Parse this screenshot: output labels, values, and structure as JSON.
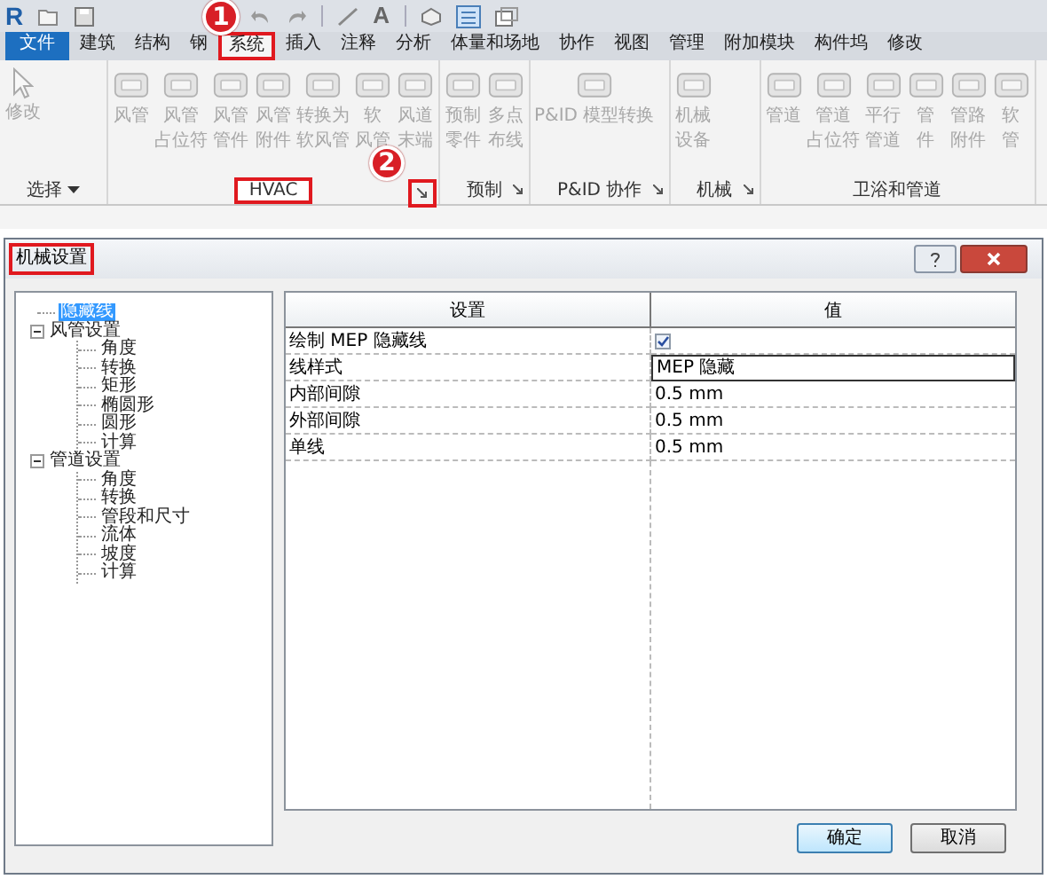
{
  "quick_access": {
    "logo": "R",
    "text_tool": "A"
  },
  "ribbon": {
    "tabs": [
      {
        "label": "文件",
        "kind": "file",
        "selected": false,
        "highlighted": false
      },
      {
        "label": "建筑",
        "kind": "tab",
        "selected": false,
        "highlighted": false
      },
      {
        "label": "结构",
        "kind": "tab",
        "selected": false,
        "highlighted": false
      },
      {
        "label": "钢",
        "kind": "tab",
        "selected": false,
        "highlighted": false
      },
      {
        "label": "系统",
        "kind": "tab",
        "selected": true,
        "highlighted": true
      },
      {
        "label": "插入",
        "kind": "tab",
        "selected": false,
        "highlighted": false
      },
      {
        "label": "注释",
        "kind": "tab",
        "selected": false,
        "highlighted": false
      },
      {
        "label": "分析",
        "kind": "tab",
        "selected": false,
        "highlighted": false
      },
      {
        "label": "体量和场地",
        "kind": "tab",
        "selected": false,
        "highlighted": false
      },
      {
        "label": "协作",
        "kind": "tab",
        "selected": false,
        "highlighted": false
      },
      {
        "label": "视图",
        "kind": "tab",
        "selected": false,
        "highlighted": false
      },
      {
        "label": "管理",
        "kind": "tab",
        "selected": false,
        "highlighted": false
      },
      {
        "label": "附加模块",
        "kind": "tab",
        "selected": false,
        "highlighted": false
      },
      {
        "label": "构件坞",
        "kind": "tab",
        "selected": false,
        "highlighted": false
      },
      {
        "label": "修改",
        "kind": "tab",
        "selected": false,
        "highlighted": false
      }
    ],
    "panels": [
      {
        "label": "选择",
        "dropdown": true,
        "highlighted": false,
        "buttons": [
          {
            "label": [
              "修改"
            ],
            "kind": "pointer",
            "disabled": true
          }
        ]
      },
      {
        "label": "HVAC",
        "highlighted": true,
        "launcher": {
          "highlighted": true
        },
        "buttons": [
          {
            "label": [
              "风管"
            ],
            "kind": "tool",
            "disabled": true
          },
          {
            "label": [
              "风管",
              "占位符"
            ],
            "kind": "tool",
            "disabled": true
          },
          {
            "label": [
              "风管",
              "管件"
            ],
            "kind": "tool",
            "disabled": true
          },
          {
            "label": [
              "风管",
              "附件"
            ],
            "kind": "tool",
            "disabled": true
          },
          {
            "label": [
              "转换为",
              "软风管"
            ],
            "kind": "tool",
            "disabled": true
          },
          {
            "label": [
              "软",
              "风管"
            ],
            "kind": "tool",
            "disabled": true
          },
          {
            "label": [
              "风道",
              "末端"
            ],
            "kind": "tool",
            "disabled": true
          }
        ]
      },
      {
        "label": "预制",
        "highlighted": false,
        "launcher": {
          "highlighted": false
        },
        "buttons": [
          {
            "label": [
              "预制",
              "零件"
            ],
            "kind": "tool",
            "disabled": true
          },
          {
            "label": [
              "多点",
              "布线"
            ],
            "kind": "tool",
            "disabled": true
          }
        ]
      },
      {
        "label": "P&ID 协作",
        "highlighted": false,
        "launcher": {
          "highlighted": false
        },
        "buttons": [
          {
            "label": [
              "P&ID 模型转换"
            ],
            "kind": "tool",
            "disabled": true
          }
        ]
      },
      {
        "label": "机械",
        "highlighted": false,
        "launcher": {
          "highlighted": false
        },
        "buttons": [
          {
            "label": [
              "机械",
              "设备"
            ],
            "kind": "tool",
            "disabled": true
          }
        ]
      },
      {
        "label": "卫浴和管道",
        "highlighted": false,
        "buttons": [
          {
            "label": [
              "管道"
            ],
            "kind": "tool",
            "disabled": true
          },
          {
            "label": [
              "管道",
              "占位符"
            ],
            "kind": "tool",
            "disabled": true
          },
          {
            "label": [
              "平行",
              "管道"
            ],
            "kind": "tool",
            "disabled": true
          },
          {
            "label": [
              "管",
              "件"
            ],
            "kind": "tool",
            "disabled": true
          },
          {
            "label": [
              "管路",
              "附件"
            ],
            "kind": "tool",
            "disabled": true
          },
          {
            "label": [
              "软",
              "管"
            ],
            "kind": "tool",
            "disabled": true
          }
        ]
      }
    ]
  },
  "callouts": [
    {
      "number": "1"
    },
    {
      "number": "2"
    }
  ],
  "dialog": {
    "title": "机械设置",
    "title_highlighted": true,
    "tree": [
      {
        "label": "隐藏线",
        "selected": true
      },
      {
        "label": "风管设置",
        "selected": false,
        "expanded": true,
        "children": [
          {
            "label": "角度",
            "selected": false
          },
          {
            "label": "转换",
            "selected": false
          },
          {
            "label": "矩形",
            "selected": false
          },
          {
            "label": "椭圆形",
            "selected": false
          },
          {
            "label": "圆形",
            "selected": false
          },
          {
            "label": "计算",
            "selected": false
          }
        ]
      },
      {
        "label": "管道设置",
        "selected": false,
        "expanded": true,
        "children": [
          {
            "label": "角度",
            "selected": false
          },
          {
            "label": "转换",
            "selected": false
          },
          {
            "label": "管段和尺寸",
            "selected": false
          },
          {
            "label": "流体",
            "selected": false
          },
          {
            "label": "坡度",
            "selected": false
          },
          {
            "label": "计算",
            "selected": false
          }
        ]
      }
    ],
    "table": {
      "columns": [
        "设置",
        "值"
      ],
      "rows": [
        {
          "setting": "绘制 MEP 隐藏线",
          "kind": "checkbox",
          "checked": true,
          "focused": false
        },
        {
          "setting": "线样式",
          "kind": "text",
          "value": "MEP 隐藏",
          "focused": true
        },
        {
          "setting": "内部间隙",
          "kind": "text",
          "value": "0.5 mm",
          "focused": false
        },
        {
          "setting": "外部间隙",
          "kind": "text",
          "value": "0.5 mm",
          "focused": false
        },
        {
          "setting": "单线",
          "kind": "text",
          "value": "0.5 mm",
          "focused": false
        }
      ]
    },
    "buttons": [
      {
        "label": "确定",
        "kind": "default"
      },
      {
        "label": "取消",
        "kind": "normal"
      }
    ]
  }
}
